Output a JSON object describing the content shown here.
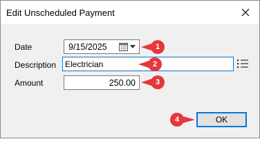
{
  "window": {
    "title": "Edit Unscheduled Payment"
  },
  "form": {
    "date_label": "Date",
    "date_value": "9/15/2025",
    "description_label": "Description",
    "description_value": "Electrician",
    "amount_label": "Amount",
    "amount_value": "250.00"
  },
  "buttons": {
    "ok_label": "OK"
  },
  "callouts": [
    "1",
    "2",
    "3",
    "4"
  ],
  "colors": {
    "callout": "#e5383b",
    "focus_border": "#0078d7",
    "dialog_bg": "#f0f0f0"
  },
  "icons": [
    "close-icon",
    "calendar-icon",
    "dropdown-arrow-icon",
    "list-icon"
  ]
}
